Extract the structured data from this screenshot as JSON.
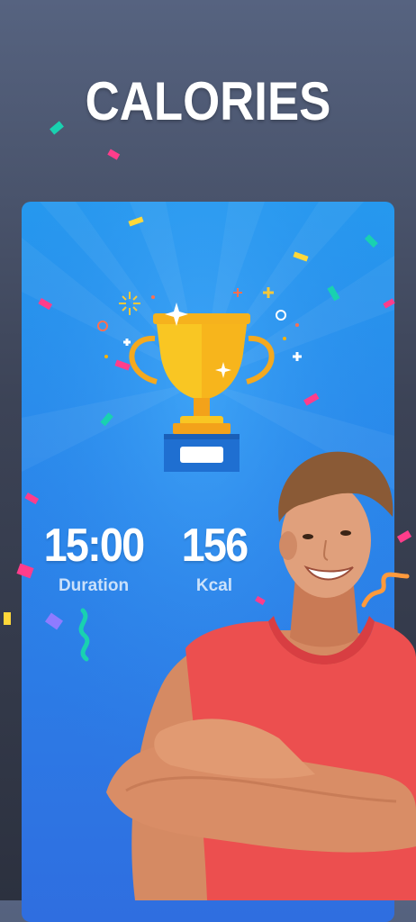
{
  "headline": "CALORIES",
  "stats": {
    "duration_value": "15:00",
    "duration_label": "Duration",
    "kcal_value": "156",
    "kcal_label": "Kcal"
  },
  "colors": {
    "background_top": "#566380",
    "card_blue": "#2a86ea",
    "trophy_gold": "#f9c623",
    "trophy_base": "#1f6fd1",
    "tank_top_red": "#ec4f4f"
  },
  "icons": {
    "trophy": "trophy-icon",
    "confetti": "confetti-decoration",
    "athlete": "athlete-illustration"
  }
}
